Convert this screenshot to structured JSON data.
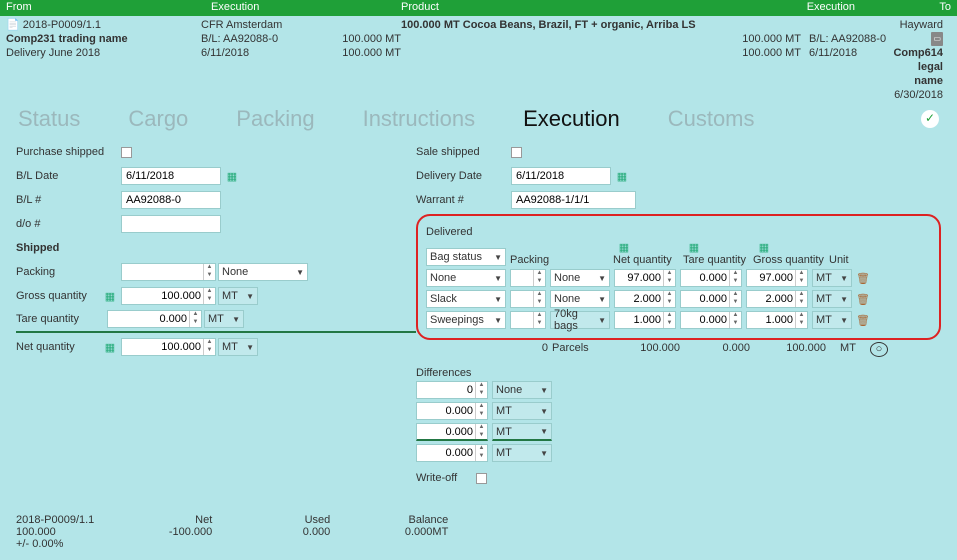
{
  "topbar": {
    "from": "From",
    "exec1": "Execution",
    "product": "Product",
    "exec2": "Execution",
    "to": "To"
  },
  "info": {
    "ref": "2018-P0009/1.1",
    "from_name": "Comp231 trading name",
    "from_delivery": "Delivery June 2018",
    "exec1_terms": "CFR Amsterdam",
    "exec1_bl": "B/L: AA92088-0",
    "exec1_date": "6/11/2018",
    "mt1": "100.000 MT",
    "mt2": "100.000 MT",
    "product": "100.000 MT Cocoa Beans, Brazil, FT + organic, Arriba LS",
    "mt3": "100.000 MT",
    "mt4": "100.000 MT",
    "exec2_bl": "B/L: AA92088-0",
    "exec2_date": "6/11/2018",
    "to_name": "Hayward",
    "to_legal": "Comp614 legal name",
    "to_date": "6/30/2018"
  },
  "tabs": {
    "t1": "Status",
    "t2": "Cargo",
    "t3": "Packing",
    "t4": "Instructions",
    "t5": "Execution",
    "t6": "Customs"
  },
  "left": {
    "purchase_shipped": "Purchase shipped",
    "bl_date_l": "B/L Date",
    "bl_date_v": "6/11/2018",
    "bl_no_l": "B/L #",
    "bl_no_v": "AA92088-0",
    "do_l": "d/o #",
    "do_v": "",
    "shipped": "Shipped",
    "packing_l": "Packing",
    "packing_sel": "None",
    "gross_l": "Gross quantity",
    "gross_v": "100.000",
    "gross_u": "MT",
    "tare_l": "Tare quantity",
    "tare_v": "0.000",
    "tare_u": "MT",
    "net_l": "Net quantity",
    "net_v": "100.000",
    "net_u": "MT"
  },
  "right": {
    "sale_shipped": "Sale shipped",
    "del_date_l": "Delivery Date",
    "del_date_v": "6/11/2018",
    "warrant_l": "Warrant #",
    "warrant_v": "AA92088-1/1/1",
    "delivered": "Delivered",
    "heads": {
      "bag": "Bag status",
      "packing": "Packing",
      "net": "Net quantity",
      "tare": "Tare quantity",
      "gross": "Gross quantity",
      "unit": "Unit"
    },
    "rows": [
      {
        "bag": "None",
        "pk": "",
        "pksel": "None",
        "net": "97.000",
        "tare": "0.000",
        "gross": "97.000",
        "unit": "MT"
      },
      {
        "bag": "Slack",
        "pk": "",
        "pksel": "None",
        "net": "2.000",
        "tare": "0.000",
        "gross": "2.000",
        "unit": "MT"
      },
      {
        "bag": "Sweepings",
        "pk": "",
        "pksel": "70kg bags",
        "net": "1.000",
        "tare": "0.000",
        "gross": "1.000",
        "unit": "MT"
      }
    ],
    "totals": {
      "parcels": "0",
      "parcels_l": "Parcels",
      "net": "100.000",
      "tare": "0.000",
      "gross": "100.000",
      "unit": "MT"
    },
    "differences": "Differences",
    "diff": [
      {
        "v": "0",
        "sel": "None"
      },
      {
        "v": "0.000",
        "sel": "MT"
      },
      {
        "v": "0.000",
        "sel": "MT"
      },
      {
        "v": "0.000",
        "sel": "MT"
      }
    ],
    "writeoff": "Write-off"
  },
  "footer": {
    "ref": "2018-P0009/1.1",
    "qty": "100.000",
    "pct": "+/- 0.00%",
    "net_l": "Net",
    "net_v": "-100.000",
    "used_l": "Used",
    "used_v": "0.000",
    "bal_l": "Balance",
    "bal_v": "0.000MT"
  }
}
